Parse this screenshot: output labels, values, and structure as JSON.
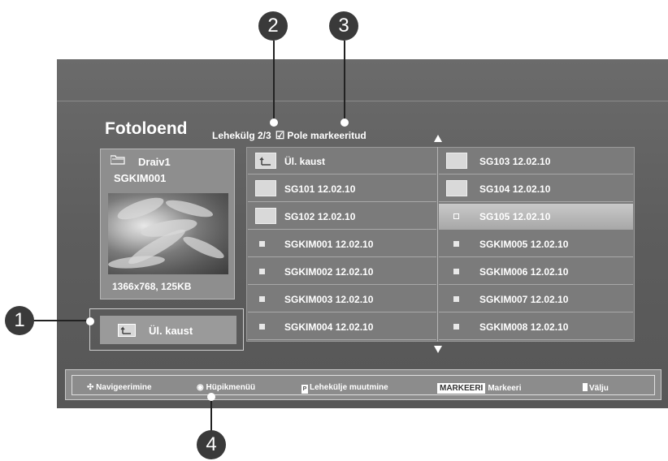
{
  "window": {
    "title": "Fotoloend"
  },
  "header": {
    "page_label": "Lehekülg 2/3",
    "mark_status": "Pole markeeritud"
  },
  "preview": {
    "drive": "Draiv1",
    "file": "SGKIM001",
    "info": "1366x768, 125KB"
  },
  "up_button": {
    "label": "Ül. kaust"
  },
  "grid": {
    "left": [
      {
        "label": "Ül. kaust",
        "icon": "folder-up-icon"
      },
      {
        "label": "SG101 12.02.10",
        "icon": "folder-icon"
      },
      {
        "label": "SG102 12.02.10",
        "icon": "folder-icon"
      },
      {
        "label": "SGKIM001 12.02.10",
        "icon": "photo-file-icon"
      },
      {
        "label": "SGKIM002 12.02.10",
        "icon": "photo-file-icon"
      },
      {
        "label": "SGKIM003 12.02.10",
        "icon": "photo-file-icon"
      },
      {
        "label": "SGKIM004 12.02.10",
        "icon": "photo-file-icon"
      }
    ],
    "right": [
      {
        "label": "SG103 12.02.10",
        "icon": "folder-icon"
      },
      {
        "label": "SG104 12.02.10",
        "icon": "folder-icon"
      },
      {
        "label": "SG105 12.02.10",
        "icon": "photo-file-icon",
        "selected": true
      },
      {
        "label": "SGKIM005 12.02.10",
        "icon": "photo-file-icon"
      },
      {
        "label": "SGKIM006 12.02.10",
        "icon": "photo-file-icon"
      },
      {
        "label": "SGKIM007 12.02.10",
        "icon": "photo-file-icon"
      },
      {
        "label": "SGKIM008 12.02.10",
        "icon": "photo-file-icon"
      }
    ]
  },
  "footer": {
    "navigate": "Navigeerimine",
    "popup": "Hüpikmenüü",
    "page_change_key": "P",
    "page_change": "Lehekülje muutmine",
    "mark_key": "MARKEERI",
    "mark": "Markeeri",
    "exit": "Välju"
  },
  "callouts": {
    "c1": "1",
    "c2": "2",
    "c3": "3",
    "c4": "4"
  },
  "colors": {
    "screen": "#616161",
    "selected_row": "#b8b8b8",
    "callout": "#3a3a3a"
  }
}
